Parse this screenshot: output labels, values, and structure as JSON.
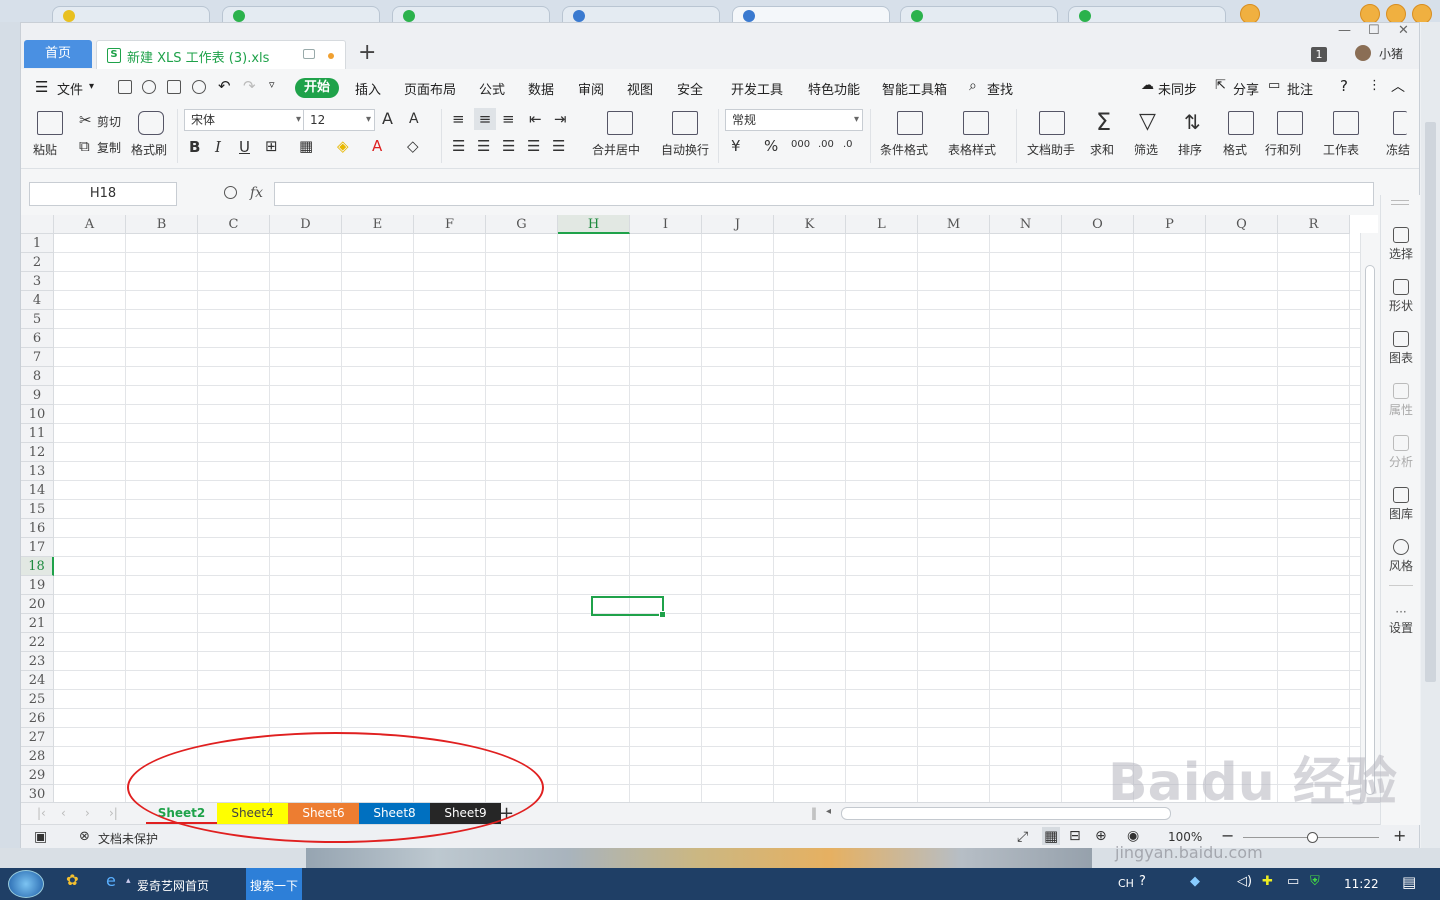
{
  "app": {
    "home_tab": "首页",
    "doc_tab_title": "新建 XLS 工作表 (3).xls",
    "new_tab": "+",
    "badge": "1",
    "username": "小猪"
  },
  "menu": {
    "file": "文件",
    "items": [
      "开始",
      "插入",
      "页面布局",
      "公式",
      "数据",
      "审阅",
      "视图",
      "安全",
      "开发工具",
      "特色功能",
      "智能工具箱",
      "查找"
    ],
    "right": {
      "sync": "未同步",
      "share": "分享",
      "comment": "批注",
      "help": "?"
    }
  },
  "ribbon": {
    "paste": "粘贴",
    "cut": "剪切",
    "copy": "复制",
    "format_painter": "格式刷",
    "font_name": "宋体",
    "font_size": "12",
    "merge_center": "合并居中",
    "wrap_text": "自动换行",
    "number_format": "常规",
    "conditional_format": "条件格式",
    "table_style": "表格样式",
    "doc_assistant": "文档助手",
    "sum": "求和",
    "filter": "筛选",
    "sort": "排序",
    "format": "格式",
    "row_col": "行和列",
    "worksheet": "工作表",
    "freeze": "冻结"
  },
  "formula_bar": {
    "namebox": "H18",
    "fx": "fx",
    "value": ""
  },
  "grid": {
    "columns": [
      "A",
      "B",
      "C",
      "D",
      "E",
      "F",
      "G",
      "H",
      "I",
      "J",
      "K",
      "L",
      "M",
      "N",
      "O",
      "P",
      "Q",
      "R"
    ],
    "rows": [
      "1",
      "2",
      "3",
      "4",
      "5",
      "6",
      "7",
      "8",
      "9",
      "10",
      "11",
      "12",
      "13",
      "14",
      "15",
      "16",
      "17",
      "18",
      "19",
      "20",
      "21",
      "22",
      "23",
      "24",
      "25",
      "26",
      "27",
      "28",
      "29",
      "30"
    ],
    "selected_col": "H",
    "selected_row": "18"
  },
  "sheets": [
    {
      "name": "Sheet2",
      "bg": "#f2f3f5",
      "fg": "#1fa24a",
      "active": true
    },
    {
      "name": "Sheet4",
      "bg": "#ffff00",
      "fg": "#444444"
    },
    {
      "name": "Sheet6",
      "bg": "#ed7d31",
      "fg": "#ffffff"
    },
    {
      "name": "Sheet8",
      "bg": "#0070c0",
      "fg": "#ffffff"
    },
    {
      "name": "Sheet9",
      "bg": "#262626",
      "fg": "#ffffff"
    }
  ],
  "add_sheet": "+",
  "side_panel": [
    "选择",
    "形状",
    "图表",
    "属性",
    "分析",
    "图库",
    "风格",
    "设置"
  ],
  "status": {
    "protect": "文档未保护",
    "zoom": "100%",
    "minus": "−",
    "plus": "+"
  },
  "taskbar": {
    "ie": "爱奇艺网首页",
    "search": "搜索一下",
    "lang": "CH",
    "time": "11:22"
  },
  "watermark": {
    "main": "Baidu 经验",
    "sub": "jingyan.baidu.com"
  },
  "colors": {
    "accent": "#1fa24a",
    "home_tab": "#4a90e2",
    "annotation": "#e02020"
  }
}
